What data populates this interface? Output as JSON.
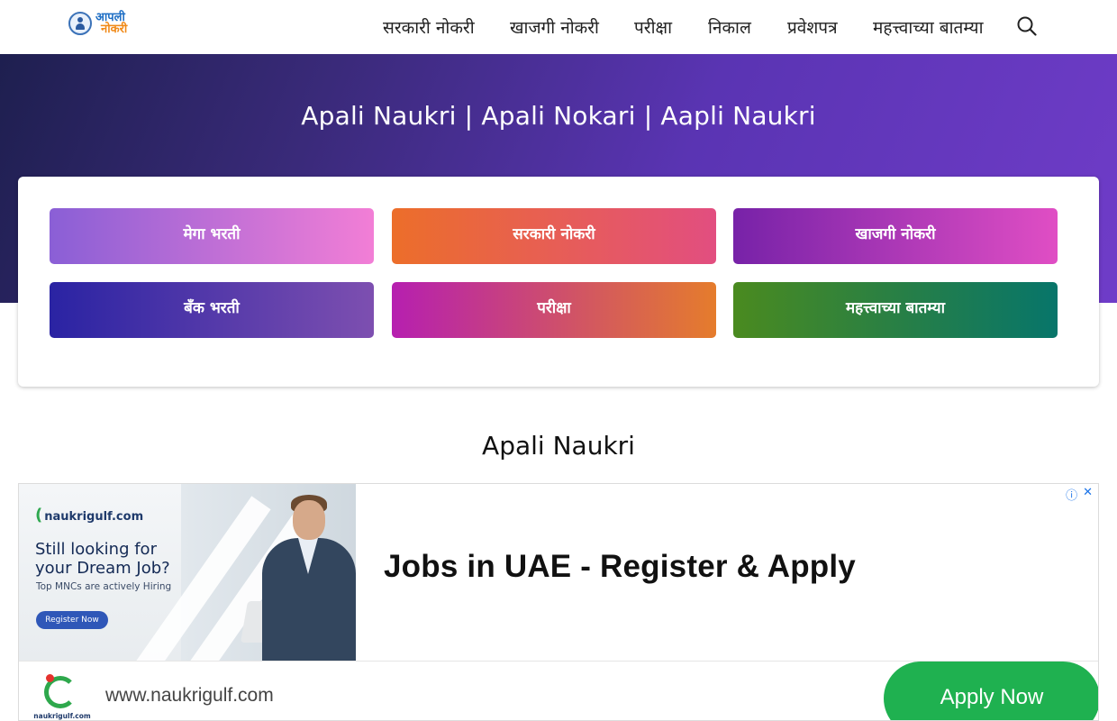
{
  "header": {
    "logo": {
      "line1": "आपली",
      "line2": "नोकरी"
    },
    "nav": [
      {
        "label": "सरकारी नोकरी"
      },
      {
        "label": "खाजगी नोकरी"
      },
      {
        "label": "परीक्षा"
      },
      {
        "label": "निकाल"
      },
      {
        "label": "प्रवेशपत्र"
      },
      {
        "label": "महत्त्वाच्या बातम्या"
      }
    ],
    "search_icon": "search-icon"
  },
  "hero": {
    "title": "Apali Naukri | Apali Nokari | Aapli Naukri"
  },
  "categories": [
    {
      "label": "मेगा भरती"
    },
    {
      "label": "सरकारी नोकरी"
    },
    {
      "label": "खाजगी नोकरी"
    },
    {
      "label": "बँक भरती"
    },
    {
      "label": "परीक्षा"
    },
    {
      "label": "महत्त्वाच्या बातम्या"
    }
  ],
  "section": {
    "title": "Apali Naukri"
  },
  "ad": {
    "brand": "naukrigulf.com",
    "headline": "Still looking for your Dream Job?",
    "tagline": "Top MNCs are actively Hiring",
    "image_button": "Register Now",
    "title": "Jobs in UAE - Register & Apply",
    "url": "www.naukrigulf.com",
    "logo_name": "naukrigulf.com",
    "cta": "Apply Now",
    "info_icon": "ⓘ",
    "close_icon": "✕",
    "colors": {
      "cta": "#1fb150",
      "brand_green": "#2ea84c",
      "brand_red": "#e5322d"
    }
  },
  "colors": {
    "hero_gradient_start": "#1e1f4f",
    "hero_gradient_end": "#6f3cc8"
  }
}
